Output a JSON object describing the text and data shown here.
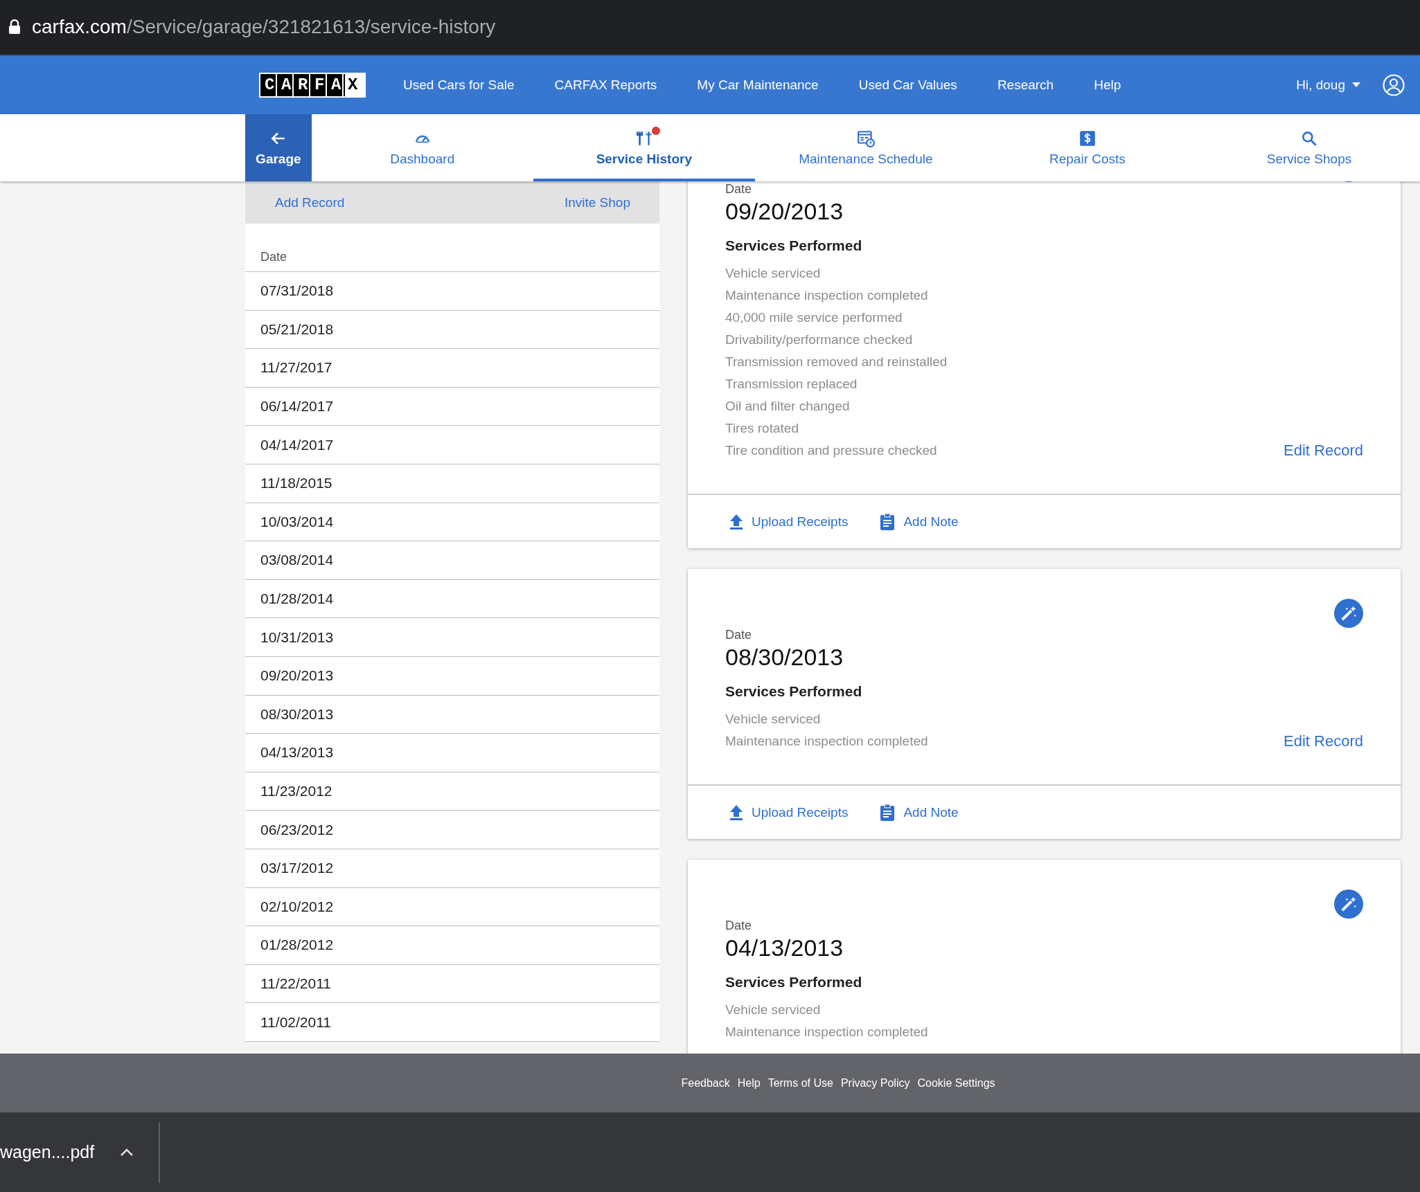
{
  "address_bar": {
    "domain": "carfax.com",
    "path": "/Service/garage/321821613/service-history"
  },
  "top_nav": {
    "logo": "CARFAX",
    "links": [
      "Used Cars for Sale",
      "CARFAX Reports",
      "My Car Maintenance",
      "Used Car Values",
      "Research",
      "Help"
    ],
    "user": "Hi, doug"
  },
  "tabs": [
    {
      "kind": "back",
      "label": "Garage",
      "selected": false,
      "notification": false
    },
    {
      "kind": "dashboard",
      "label": "Dashboard",
      "selected": false,
      "notification": false
    },
    {
      "kind": "history",
      "label": "Service History",
      "selected": true,
      "notification": true
    },
    {
      "kind": "schedule",
      "label": "Maintenance Schedule",
      "selected": false,
      "notification": false
    },
    {
      "kind": "costs",
      "label": "Repair Costs",
      "selected": false,
      "notification": false
    },
    {
      "kind": "shops",
      "label": "Service Shops",
      "selected": false,
      "notification": false
    }
  ],
  "history_panel": {
    "actions": [
      "Add Record",
      "Invite Shop"
    ],
    "column": "Date",
    "rows": [
      "07/31/2018",
      "05/21/2018",
      "11/27/2017",
      "06/14/2017",
      "04/14/2017",
      "11/18/2015",
      "10/03/2014",
      "03/08/2014",
      "01/28/2014",
      "10/31/2013",
      "09/20/2013",
      "08/30/2013",
      "04/13/2013",
      "11/23/2012",
      "06/23/2012",
      "03/17/2012",
      "02/10/2012",
      "01/28/2012",
      "11/22/2011",
      "11/02/2011"
    ]
  },
  "records": [
    {
      "date_label": "Date",
      "date": "09/20/2013",
      "heading": "Services Performed",
      "services": [
        "Vehicle serviced",
        "Maintenance inspection completed",
        "40,000 mile service performed",
        "Drivability/performance checked",
        "Transmission removed and reinstalled",
        "Transmission replaced",
        "Oil and filter changed",
        "Tires rotated",
        "Tire condition and pressure checked"
      ],
      "edit_link": "Edit Record",
      "actions": [
        {
          "kind": "upload",
          "label": "Upload Receipts"
        },
        {
          "kind": "note",
          "label": "Add Note"
        }
      ]
    },
    {
      "date_label": "Date",
      "date": "08/30/2013",
      "heading": "Services Performed",
      "services": [
        "Vehicle serviced",
        "Maintenance inspection completed"
      ],
      "edit_link": "Edit Record",
      "actions": [
        {
          "kind": "upload",
          "label": "Upload Receipts"
        },
        {
          "kind": "note",
          "label": "Add Note"
        }
      ]
    },
    {
      "date_label": "Date",
      "date": "04/13/2013",
      "heading": "Services Performed",
      "services": [
        "Vehicle serviced",
        "Maintenance inspection completed"
      ]
    }
  ],
  "footer_links": [
    "Feedback",
    "Help",
    "Terms of Use",
    "Privacy Policy",
    "Cookie Settings"
  ],
  "download_bar": {
    "file": "wagen....pdf"
  }
}
